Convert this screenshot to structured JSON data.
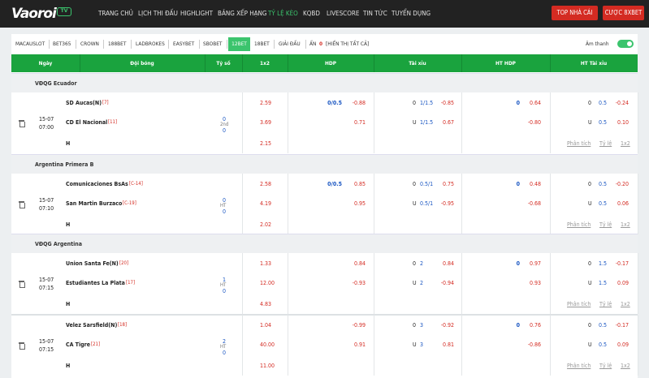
{
  "brand": {
    "logo_text": "Vaoroi",
    "logo_tv": "TV"
  },
  "nav": [
    "TRANG CHỦ",
    "LỊCH THI ĐẤU",
    "HIGHLIGHT",
    "BẢNG XẾP HẠNG",
    "TỶ LỆ KÈO",
    "KQBD",
    "LIVESCORE",
    "TIN TỨC",
    "TUYỂN DỤNG"
  ],
  "nav_active": "TỶ LỆ KÈO",
  "buttons": {
    "top": "TOP NHÀ CÁI",
    "bet": "CƯỢC 8XBET"
  },
  "bookmakers": [
    "MACAUSLOT",
    "BET365",
    "CROWN",
    "188BET",
    "LADBROKES",
    "EASYBET",
    "SBOBET",
    "12BET",
    "18BET",
    "GIẢI ĐẤU"
  ],
  "bookmaker_active": "12BET",
  "hidden": {
    "label": "ẨN",
    "count": "0",
    "show_all": "[HIỂN THỊ TẤT CẢ]"
  },
  "sound_label": "Âm thanh",
  "columns": [
    "Ngày",
    "Đội bóng",
    "Tỷ số",
    "1x2",
    "HDP",
    "Tài xỉu",
    "HT HDP",
    "HT Tài xỉu"
  ],
  "links": [
    "Phân tích",
    "Tỷ lệ",
    "1x2"
  ],
  "leagues": [
    {
      "name": "VĐQG Ecuador",
      "date": "15-07",
      "time": "07:00",
      "home": "SD Aucas(N)",
      "home_tag": "[7]",
      "away": "CD El Nacional",
      "away_tag": "[11]",
      "score_h": "0",
      "score_mid": "2nd",
      "score_a": "0",
      "x1": "2.59",
      "x2": "3.69",
      "x3": "2.15",
      "hdp": [
        "0/0.5",
        "-0.88",
        "",
        "0.71"
      ],
      "tx": [
        "0",
        "1/1.5",
        "-0.85",
        "U",
        "1/1.5",
        "0.67"
      ],
      "hthdp": [
        "0",
        "0.64",
        "",
        "-0.80"
      ],
      "httx": [
        "0",
        "0.5",
        "-0.24",
        "U",
        "0.5",
        "0.10"
      ]
    },
    {
      "name": "Argentina Primera B",
      "date": "15-07",
      "time": "07:10",
      "home": "Comunicaciones BsAs",
      "home_tag": "[C-14]",
      "away": "San Martin Burzaco",
      "away_tag": "[C-19]",
      "score_h": "0",
      "score_mid": "HT",
      "score_a": "0",
      "x1": "2.58",
      "x2": "4.19",
      "x3": "2.02",
      "hdp": [
        "0/0.5",
        "0.85",
        "",
        "0.95"
      ],
      "tx": [
        "0",
        "0.5/1",
        "0.75",
        "U",
        "0.5/1",
        "-0.95"
      ],
      "hthdp": [
        "0",
        "0.48",
        "",
        "-0.68"
      ],
      "httx": [
        "0",
        "0.5",
        "-0.20",
        "U",
        "0.5",
        "0.06"
      ]
    },
    {
      "name": "VĐQG Argentina",
      "date": "15-07",
      "time": "07:15",
      "home": "Union Santa Fe(N)",
      "home_tag": "[20]",
      "away": "Estudiantes La Plata",
      "away_tag": "[17]",
      "score_h": "1",
      "score_mid": "HT",
      "score_a": "0",
      "x1": "1.33",
      "x2": "12.00",
      "x3": "4.83",
      "hdp": [
        "",
        "0.84",
        "",
        "-0.93"
      ],
      "tx": [
        "0",
        "2",
        "0.84",
        "U",
        "2",
        "-0.94"
      ],
      "hthdp": [
        "0",
        "0.97",
        "",
        "0.93"
      ],
      "httx": [
        "0",
        "1.5",
        "-0.17",
        "U",
        "1.5",
        "0.09"
      ]
    },
    {
      "name": "",
      "date": "15-07",
      "time": "07:15",
      "home": "Velez Sarsfield(N)",
      "home_tag": "[18]",
      "away": "CA Tigre",
      "away_tag": "[21]",
      "score_h": "2",
      "score_mid": "HT",
      "score_a": "0",
      "x1": "1.04",
      "x2": "40.00",
      "x3": "11.00",
      "hdp": [
        "",
        "-0.99",
        "",
        "0.91"
      ],
      "tx": [
        "0",
        "3",
        "-0.92",
        "U",
        "3",
        "0.81"
      ],
      "hthdp": [
        "0",
        "0.76",
        "",
        "-0.86"
      ],
      "httx": [
        "0",
        "0.5",
        "-0.17",
        "U",
        "0.5",
        "0.09"
      ]
    }
  ],
  "draw_label": "H"
}
